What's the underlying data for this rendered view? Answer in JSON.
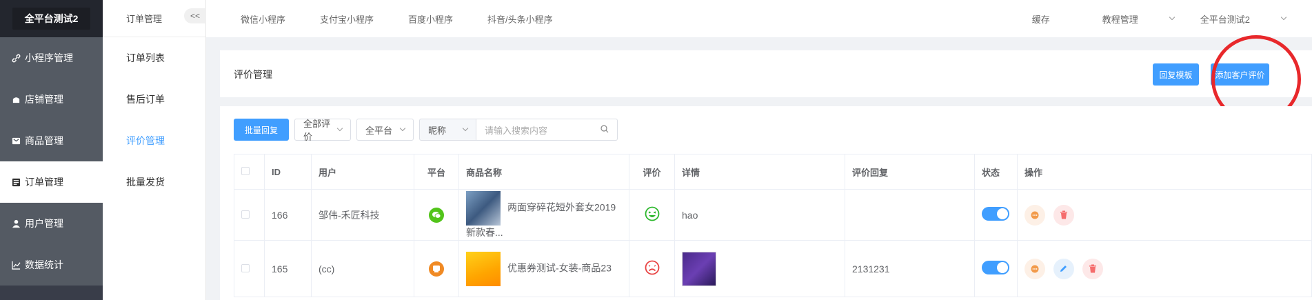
{
  "brand": "全平台测试2",
  "sidebar": {
    "items": [
      {
        "label": "小程序管理",
        "icon": "link-icon",
        "active": false
      },
      {
        "label": "店铺管理",
        "icon": "store-icon",
        "active": false
      },
      {
        "label": "商品管理",
        "icon": "goods-icon",
        "active": false
      },
      {
        "label": "订单管理",
        "icon": "order-icon",
        "active": true
      },
      {
        "label": "用户管理",
        "icon": "user-icon",
        "active": false
      },
      {
        "label": "数据统计",
        "icon": "chart-icon",
        "active": false
      }
    ]
  },
  "subbar": {
    "title": "订单管理",
    "collapse": "<<",
    "items": [
      {
        "label": "订单列表"
      },
      {
        "label": "售后订单"
      },
      {
        "label": "评价管理"
      },
      {
        "label": "批量发货"
      }
    ]
  },
  "topnav": {
    "tabs": [
      "微信小程序",
      "支付宝小程序",
      "百度小程序",
      "抖音/头条小程序"
    ],
    "cache": "缓存",
    "tutorial": "教程管理",
    "account": "全平台测试2"
  },
  "page": {
    "title": "评价管理",
    "reply_template": "回复模板",
    "add_review": "添加客户评价"
  },
  "filters": {
    "batch_reply": "批量回复",
    "rating": "全部评价",
    "platform": "全平台",
    "field": "昵称",
    "search_placeholder": "请输入搜索内容"
  },
  "table": {
    "columns": [
      "ID",
      "用户",
      "平台",
      "商品名称",
      "评价",
      "详情",
      "评价回复",
      "状态",
      "操作"
    ],
    "rows": [
      {
        "id": "166",
        "user": "邹伟-禾匠科技",
        "platform": "wechat",
        "product": "两面穿碎花短外套女2019新款春...",
        "rating": "good",
        "detail": "hao",
        "reply": "",
        "status": true
      },
      {
        "id": "165",
        "user": "(cc)",
        "platform": "other",
        "product": "优惠券测试-女装-商品23",
        "rating": "bad",
        "detail": "",
        "reply": "2131231",
        "status": true
      }
    ]
  },
  "colors": {
    "primary": "#409eff",
    "sidebar_bg": "#393d49",
    "annotation": "#e8282b"
  }
}
